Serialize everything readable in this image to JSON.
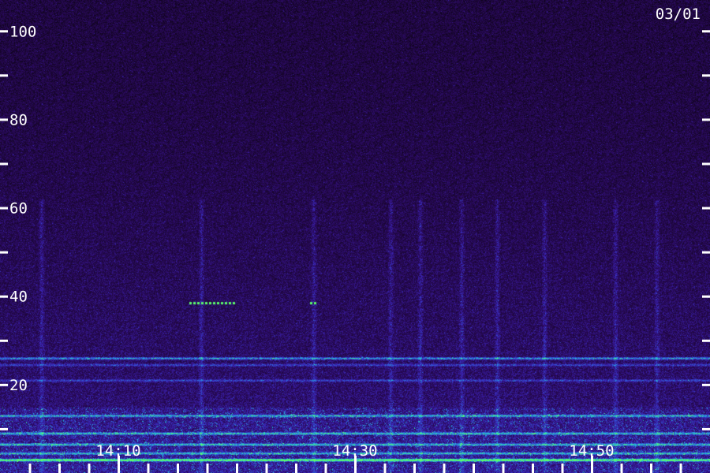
{
  "date_label": "03/01",
  "chart_data": {
    "type": "heatmap",
    "title": "",
    "xlabel": "",
    "ylabel": "",
    "y_ticks": [
      20,
      40,
      60,
      80,
      100
    ],
    "y_minor_ticks": [
      10,
      30,
      50,
      70,
      90
    ],
    "ylim": [
      0,
      107
    ],
    "x_ticks": [
      "14:10",
      "14:30",
      "14:50"
    ],
    "x_tick_minutes": [
      10,
      30,
      50
    ],
    "xlim_minutes": [
      0,
      60
    ],
    "x_minor_step_minutes": 2.5,
    "colormap": [
      "#000000",
      "#1a0633",
      "#2a0a5e",
      "#3a22b0",
      "#2f5fd8",
      "#25c0d8",
      "#5cff6a"
    ],
    "tick_color": "#ffffff",
    "features": {
      "horizontal_bands": [
        {
          "y": 26,
          "intensity": 0.55
        },
        {
          "y": 24.5,
          "intensity": 0.3
        },
        {
          "y": 21,
          "intensity": 0.3
        },
        {
          "y": 13,
          "intensity": 0.5
        },
        {
          "y": 9,
          "intensity": 0.55
        },
        {
          "y": 6.5,
          "intensity": 0.55
        },
        {
          "y": 4.5,
          "intensity": 0.5
        },
        {
          "y": 3,
          "intensity": 0.95
        }
      ],
      "vertical_streaks_minutes": [
        3.5,
        17,
        26.5,
        33,
        35.5,
        39,
        42,
        46,
        52,
        55.5
      ],
      "tone_segments": [
        {
          "x_start_minutes": 16,
          "x_end_minutes": 19.8,
          "y": 38.5
        },
        {
          "x_start_minutes": 26.2,
          "x_end_minutes": 26.8,
          "y": 38.5
        }
      ]
    }
  }
}
